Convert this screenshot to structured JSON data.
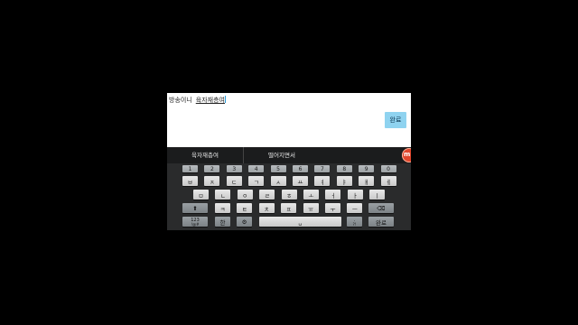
{
  "input": {
    "committed_text": "방송이니",
    "composing_text": "육자재층여",
    "done_label": "완료"
  },
  "suggestions": [
    "육자재층여",
    "떨어지면서"
  ],
  "keyboard": {
    "number_row": [
      "1",
      "2",
      "3",
      "4",
      "5",
      "6",
      "7",
      "8",
      "9",
      "0"
    ],
    "row1": [
      "ㅂ",
      "ㅈ",
      "ㄷ",
      "ㄱ",
      "ㅅ",
      "ㅛ",
      "ㅕ",
      "ㅑ",
      "ㅐ",
      "ㅔ"
    ],
    "row2": [
      "ㅁ",
      "ㄴ",
      "ㅇ",
      "ㄹ",
      "ㅎ",
      "ㅗ",
      "ㅓ",
      "ㅏ",
      "ㅣ"
    ],
    "row3": [
      "ㅋ",
      "ㅌ",
      "ㅊ",
      "ㅍ",
      "ㅠ",
      "ㅜ",
      "ㅡ"
    ],
    "shift_icon": "⬆",
    "backspace_icon": "⌫",
    "symbols_label": "123",
    "symbols_sub": "!@#",
    "mode_label": "한",
    "space_icon": "␣",
    "period_label": ".",
    "period_sub": "?!",
    "enter_label": "완료",
    "settings_icon": "⚙"
  },
  "colors": {
    "accent": "#8fd3f0",
    "caret": "#2a9bd8",
    "orb": "#e0462d"
  }
}
